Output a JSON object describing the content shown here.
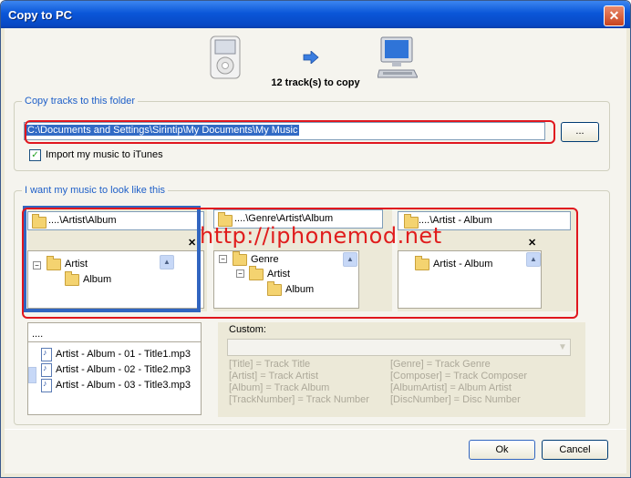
{
  "window": {
    "title": "Copy to PC",
    "close_glyph": "✕"
  },
  "transfer": {
    "status": "12 track(s) to copy",
    "source_icon": "ipod-icon",
    "arrow_icon": "arrow-right-icon",
    "dest_icon": "computer-icon"
  },
  "folder_group": {
    "legend": "Copy tracks to this folder",
    "path": "C:\\Documents and Settings\\Sirintip\\My Documents\\My Music",
    "browse_label": "...",
    "import_label": "Import my music to iTunes",
    "import_checked": "✓"
  },
  "style_group": {
    "legend": "I want my music to look like this",
    "options": [
      {
        "path": "....\\Artist\\Album",
        "tree": [
          "Artist",
          "Album"
        ]
      },
      {
        "path": "....\\Genre\\Artist\\Album",
        "tree": [
          "Genre",
          "Artist",
          "Album"
        ]
      },
      {
        "path": "....\\Artist - Album",
        "tree": [
          "Artist - Album"
        ]
      }
    ],
    "close_glyph": "✕",
    "minus_glyph": "−",
    "preview_header": "....",
    "preview_files": [
      "Artist - Album - 01 - Title1.mp3",
      "Artist - Album - 02 - Title2.mp3",
      "Artist - Album - 03 - Title3.mp3"
    ],
    "custom_label": "Custom:",
    "tokens_left": [
      "[Title] = Track Title",
      "[Artist] = Track Artist",
      "[Album] = Track Album",
      "[TrackNumber] = Track Number"
    ],
    "tokens_right": [
      "[Genre] = Track Genre",
      "[Composer] = Track Composer",
      "[AlbumArtist] = Album Artist",
      "[DiscNumber] = Disc Number"
    ]
  },
  "buttons": {
    "ok": "Ok",
    "cancel": "Cancel"
  },
  "watermark": "http://iphonemod.net",
  "colors": {
    "title_bar": "#0a56d8",
    "legend": "#1e5fc8",
    "highlight": "#e0161e",
    "selection": "#3165c0"
  }
}
